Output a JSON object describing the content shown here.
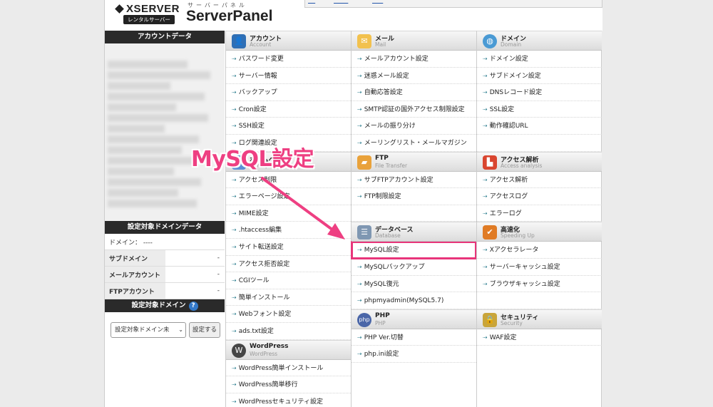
{
  "header": {
    "brand": "XSERVER",
    "brand_sub": "レンタルサーバー",
    "panel_kana": "サーバーパネル",
    "panel_name": "ServerPanel"
  },
  "left": {
    "account_title": "アカウントデータ",
    "domain_data_title": "設定対象ドメインデータ",
    "domain_line": "ドメイン： ----",
    "rows": [
      {
        "label": "サブドメイン",
        "value": "-"
      },
      {
        "label": "メールアカウント",
        "value": "-"
      },
      {
        "label": "FTPアカウント",
        "value": "-"
      }
    ],
    "target_domain_title": "設定対象ドメイン",
    "help_icon": "?",
    "select_value": "設定対象ドメイン未",
    "set_button": "設定する"
  },
  "sections": {
    "account": {
      "title": "アカウント",
      "sub": "Account",
      "items": [
        "パスワード変更",
        "サーバー情報",
        "バックアップ",
        "Cron設定",
        "SSH設定",
        "ログ関連設定"
      ]
    },
    "homepage": {
      "title": "ホームページ",
      "sub": "Homepage",
      "items": [
        "アクセス制限",
        "エラーページ設定",
        "MIME設定",
        ".htaccess編集",
        "サイト転送設定",
        "アクセス拒否設定",
        "CGIツール",
        "簡単インストール",
        "Webフォント設定",
        "ads.txt設定"
      ]
    },
    "wordpress": {
      "title": "WordPress",
      "sub": "WordPress",
      "items": [
        "WordPress簡単インストール",
        "WordPress簡単移行",
        "WordPressセキュリティ設定"
      ]
    },
    "mail": {
      "title": "メール",
      "sub": "Mail",
      "items": [
        "メールアカウント設定",
        "迷惑メール設定",
        "自動応答設定",
        "SMTP認証の国外アクセス制限設定",
        "メールの振り分け",
        "メーリングリスト・メールマガジン"
      ]
    },
    "ftp": {
      "title": "FTP",
      "sub": "File Transfer",
      "items": [
        "サブFTPアカウント設定",
        "FTP制限設定"
      ]
    },
    "database": {
      "title": "データベース",
      "sub": "Database",
      "items": [
        "MySQL設定",
        "MySQLバックアップ",
        "MySQL復元",
        "phpmyadmin(MySQL5.7)"
      ]
    },
    "php": {
      "title": "PHP",
      "sub": "PHP",
      "items": [
        "PHP Ver.切替",
        "php.ini設定"
      ]
    },
    "domain": {
      "title": "ドメイン",
      "sub": "Domain",
      "items": [
        "ドメイン設定",
        "サブドメイン設定",
        "DNSレコード設定",
        "SSL設定",
        "動作確認URL"
      ]
    },
    "analytics": {
      "title": "アクセス解析",
      "sub": "Access analysis",
      "items": [
        "アクセス解析",
        "アクセスログ",
        "エラーログ"
      ]
    },
    "speed": {
      "title": "高速化",
      "sub": "Speeding Up",
      "items": [
        "Xアクセラレータ",
        "サーバーキャッシュ設定",
        "ブラウザキャッシュ設定"
      ]
    },
    "security": {
      "title": "セキュリティ",
      "sub": "Security",
      "items": [
        "WAF設定"
      ]
    }
  },
  "annotation": {
    "text": "MySQL設定",
    "color": "#ee3f82"
  },
  "colors": {
    "highlight": "#e8357a",
    "link_arrow": "#2a7c8e"
  }
}
